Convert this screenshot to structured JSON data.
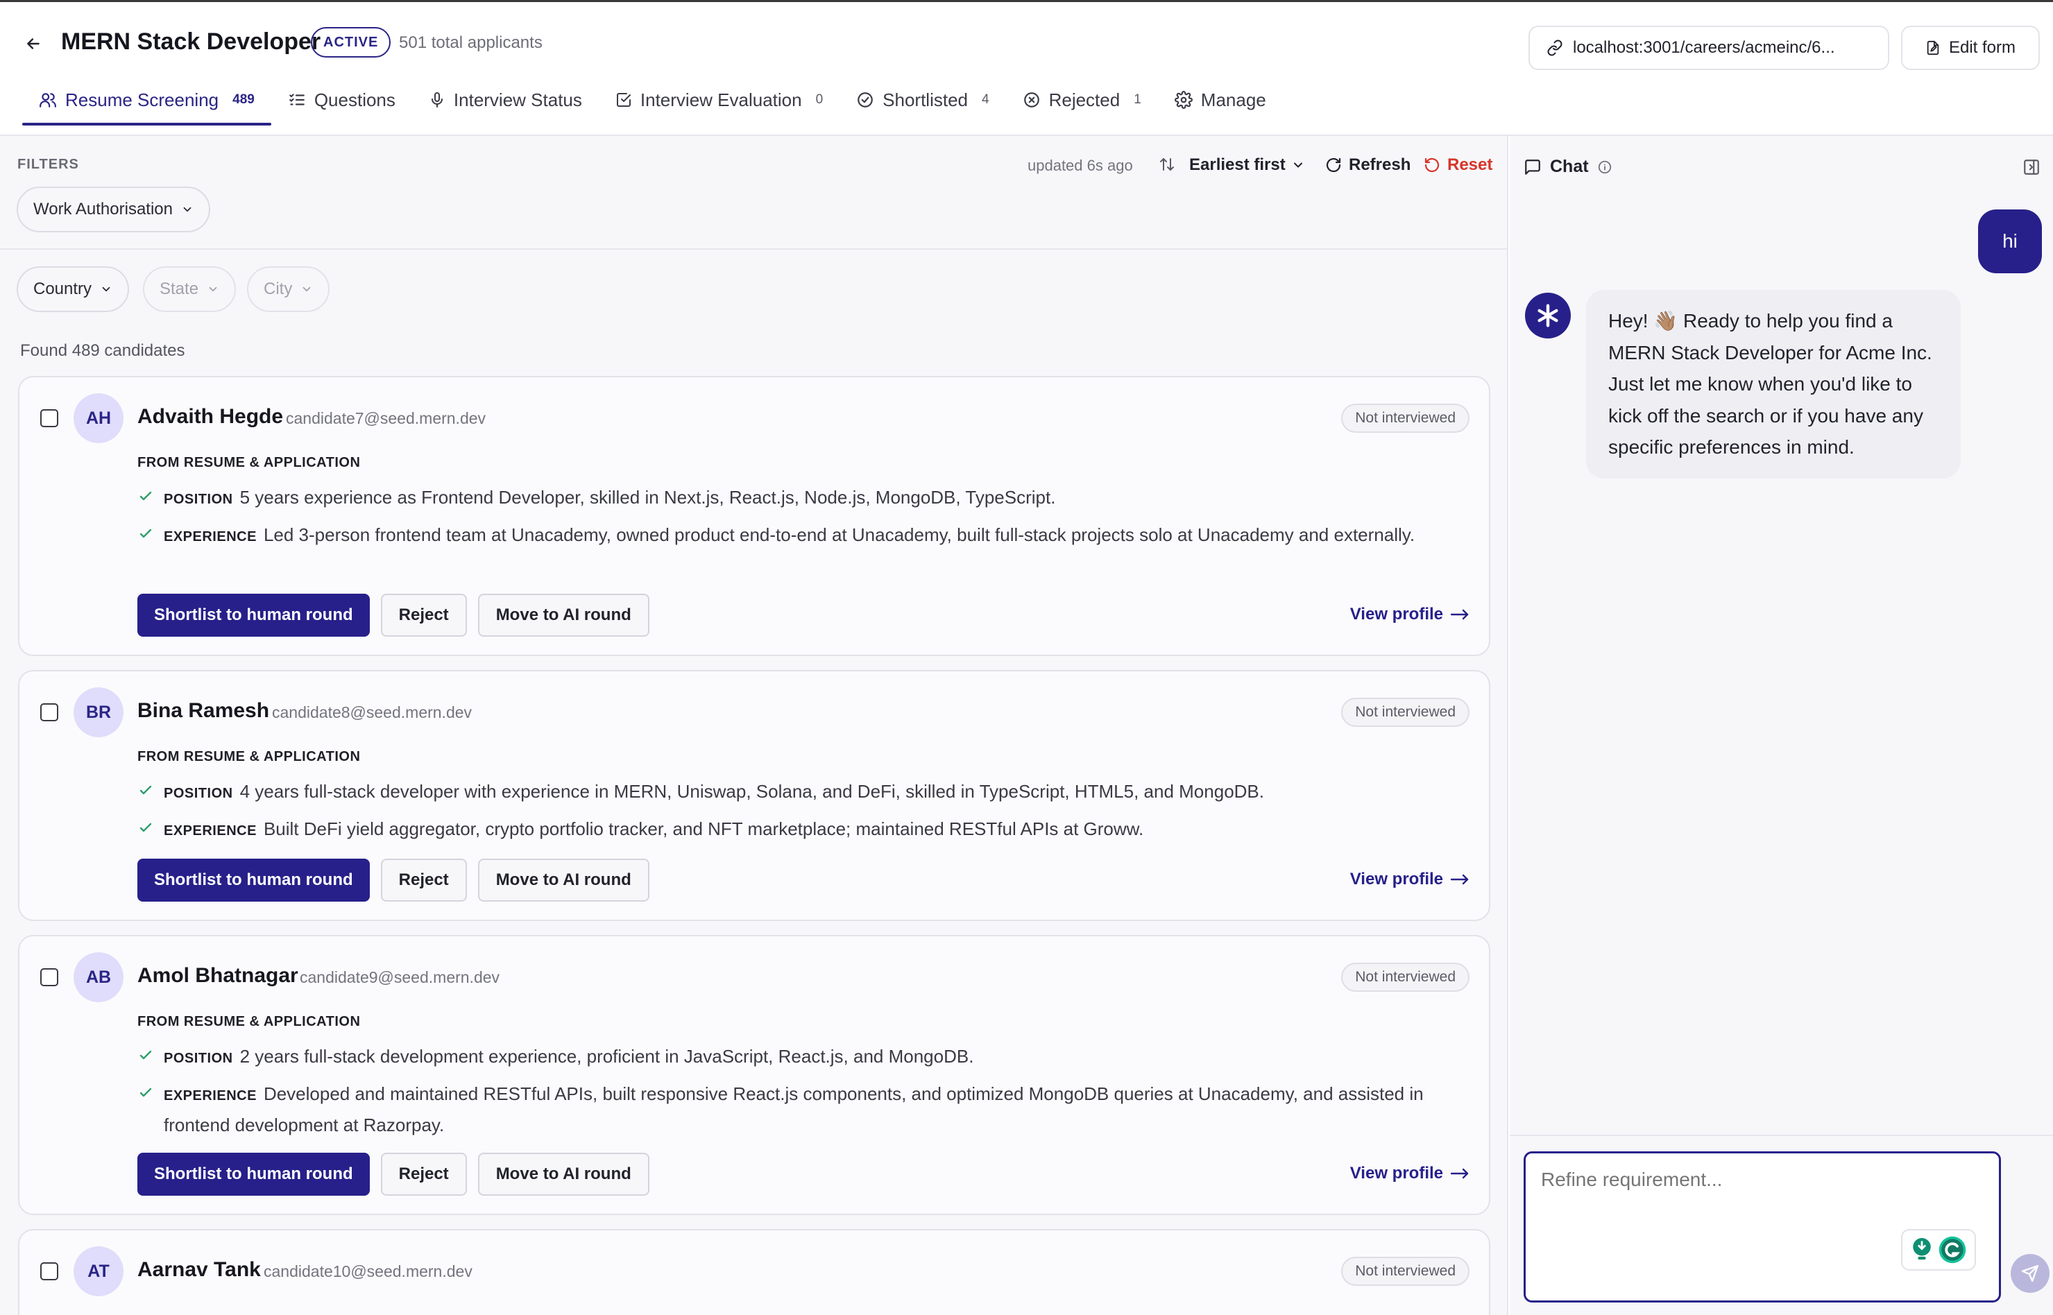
{
  "header": {
    "back_icon": "arrow-left-icon",
    "job_title": "MERN Stack Developer",
    "status_badge": "ACTIVE",
    "applicants": "501 total applicants",
    "career_url": "localhost:3001/careers/acmeinc/6...",
    "edit_form_label": "Edit form"
  },
  "tabs": [
    {
      "label": "Resume Screening",
      "count": "489",
      "icon": "users-icon",
      "active": true
    },
    {
      "label": "Questions",
      "count": "",
      "icon": "list-checks-icon",
      "active": false
    },
    {
      "label": "Interview Status",
      "count": "",
      "icon": "microphone-icon",
      "active": false
    },
    {
      "label": "Interview Evaluation",
      "count": "0",
      "icon": "check-square-icon",
      "active": false
    },
    {
      "label": "Shortlisted",
      "count": "4",
      "icon": "check-circle-icon",
      "active": false
    },
    {
      "label": "Rejected",
      "count": "1",
      "icon": "x-circle-icon",
      "active": false
    },
    {
      "label": "Manage",
      "count": "",
      "icon": "gear-icon",
      "active": false
    }
  ],
  "filters": {
    "label": "FILTERS",
    "work_authorisation": "Work Authorisation",
    "country": "Country",
    "state": "State",
    "city": "City",
    "updated": "updated 6s ago",
    "sort": "Earliest first",
    "refresh": "Refresh",
    "reset": "Reset"
  },
  "results": {
    "found": "Found 489 candidates"
  },
  "candidates": [
    {
      "initials": "AH",
      "name": "Advaith Hegde",
      "email": "candidate7@seed.mern.dev",
      "status": "Not interviewed",
      "section_label": "FROM RESUME & APPLICATION",
      "position_tag": "POSITION",
      "position": "5 years experience as Frontend Developer, skilled in Next.js, React.js, Node.js, MongoDB, TypeScript.",
      "experience_tag": "EXPERIENCE",
      "experience": "Led 3-person frontend team at Unacademy, owned product end-to-end at Unacademy, built full-stack projects solo at Unacademy and externally.",
      "shortlist": "Shortlist to human round",
      "reject": "Reject",
      "move_ai": "Move to AI round",
      "view_profile": "View profile"
    },
    {
      "initials": "BR",
      "name": "Bina Ramesh",
      "email": "candidate8@seed.mern.dev",
      "status": "Not interviewed",
      "section_label": "FROM RESUME & APPLICATION",
      "position_tag": "POSITION",
      "position": "4 years full-stack developer with experience in MERN, Uniswap, Solana, and DeFi, skilled in TypeScript, HTML5, and MongoDB.",
      "experience_tag": "EXPERIENCE",
      "experience": "Built DeFi yield aggregator, crypto portfolio tracker, and NFT marketplace; maintained RESTful APIs at Groww.",
      "shortlist": "Shortlist to human round",
      "reject": "Reject",
      "move_ai": "Move to AI round",
      "view_profile": "View profile"
    },
    {
      "initials": "AB",
      "name": "Amol Bhatnagar",
      "email": "candidate9@seed.mern.dev",
      "status": "Not interviewed",
      "section_label": "FROM RESUME & APPLICATION",
      "position_tag": "POSITION",
      "position": "2 years full-stack development experience, proficient in JavaScript, React.js, and MongoDB.",
      "experience_tag": "EXPERIENCE",
      "experience": "Developed and maintained RESTful APIs, built responsive React.js components, and optimized MongoDB queries at Unacademy, and assisted in frontend development at Razorpay.",
      "shortlist": "Shortlist to human round",
      "reject": "Reject",
      "move_ai": "Move to AI round",
      "view_profile": "View profile"
    },
    {
      "initials": "AT",
      "name": "Aarnav Tank",
      "email": "candidate10@seed.mern.dev",
      "status": "Not interviewed"
    }
  ],
  "chat": {
    "title": "Chat",
    "user_message": "hi",
    "bot_message": "Hey! 👋🏽 Ready to help you find a MERN Stack Developer for Acme Inc. Just let me know when you'd like to kick off the search or if you have any specific preferences in mind.",
    "input_placeholder": "Refine requirement..."
  },
  "colors": {
    "accent": "#27208a",
    "danger": "#d8352a",
    "check": "#2f9e6b"
  }
}
